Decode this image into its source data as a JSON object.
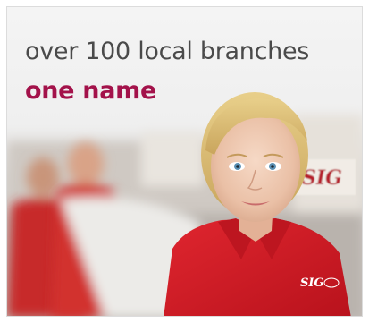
{
  "ad": {
    "headline": "over 100 local branches",
    "tagline": "one name",
    "brand_logo_text": "SIG"
  },
  "colors": {
    "brand_red": "#a3124a",
    "shirt_red": "#d01f2a",
    "headline_gray": "#4a4a4a",
    "background": "#efefef"
  }
}
